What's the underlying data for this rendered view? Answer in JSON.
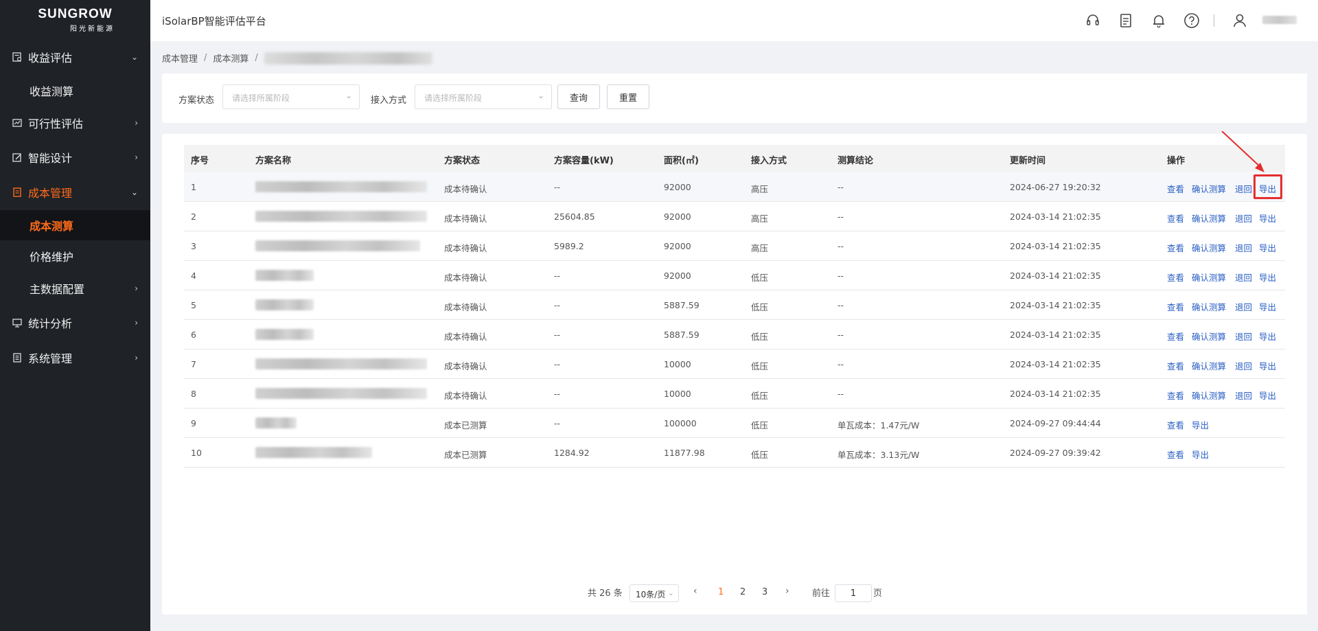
{
  "logo": {
    "brand": "SUNGROW",
    "sub": "阳光新能源"
  },
  "header": {
    "title": "iSolarBP智能评估平台"
  },
  "sidebar": {
    "items": [
      {
        "label": "收益评估"
      },
      {
        "label": "收益测算"
      },
      {
        "label": "可行性评估"
      },
      {
        "label": "智能设计"
      },
      {
        "label": "成本管理"
      },
      {
        "label": "成本测算"
      },
      {
        "label": "价格维护"
      },
      {
        "label": "主数据配置"
      },
      {
        "label": "统计分析"
      },
      {
        "label": "系统管理"
      }
    ]
  },
  "breadcrumb": {
    "level1": "成本管理",
    "level2": "成本测算",
    "sep": "/"
  },
  "filters": {
    "status_label": "方案状态",
    "status_placeholder": "请选择所属阶段",
    "access_label": "接入方式",
    "access_placeholder": "请选择所属阶段",
    "query_label": "查询",
    "reset_label": "重置"
  },
  "table": {
    "columns": [
      "序号",
      "方案名称",
      "方案状态",
      "方案容量(kW)",
      "面积(㎡)",
      "接入方式",
      "测算结论",
      "更新时间",
      "操作"
    ],
    "ops": {
      "view": "查看",
      "confirm": "确认测算",
      "back": "退回",
      "export": "导出"
    },
    "rows": [
      {
        "no": "1",
        "status": "成本待确认",
        "capacity": "--",
        "area": "92000",
        "access": "高压",
        "result": "--",
        "time": "2024-06-27 19:20:32"
      },
      {
        "no": "2",
        "status": "成本待确认",
        "capacity": "25604.85",
        "area": "92000",
        "access": "高压",
        "result": "--",
        "time": "2024-03-14 21:02:35"
      },
      {
        "no": "3",
        "status": "成本待确认",
        "capacity": "5989.2",
        "area": "92000",
        "access": "高压",
        "result": "--",
        "time": "2024-03-14 21:02:35"
      },
      {
        "no": "4",
        "status": "成本待确认",
        "capacity": "--",
        "area": "92000",
        "access": "低压",
        "result": "--",
        "time": "2024-03-14 21:02:35"
      },
      {
        "no": "5",
        "status": "成本待确认",
        "capacity": "--",
        "area": "5887.59",
        "access": "低压",
        "result": "--",
        "time": "2024-03-14 21:02:35"
      },
      {
        "no": "6",
        "status": "成本待确认",
        "capacity": "--",
        "area": "5887.59",
        "access": "低压",
        "result": "--",
        "time": "2024-03-14 21:02:35"
      },
      {
        "no": "7",
        "status": "成本待确认",
        "capacity": "--",
        "area": "10000",
        "access": "低压",
        "result": "--",
        "time": "2024-03-14 21:02:35"
      },
      {
        "no": "8",
        "status": "成本待确认",
        "capacity": "--",
        "area": "10000",
        "access": "低压",
        "result": "--",
        "time": "2024-03-14 21:02:35"
      },
      {
        "no": "9",
        "status": "成本已测算",
        "capacity": "--",
        "area": "100000",
        "access": "低压",
        "result": "单瓦成本：1.47元/W",
        "time": "2024-09-27 09:44:44"
      },
      {
        "no": "10",
        "status": "成本已测算",
        "capacity": "1284.92",
        "area": "11877.98",
        "access": "低压",
        "result": "单瓦成本：3.13元/W",
        "time": "2024-09-27 09:39:42"
      }
    ]
  },
  "pagination": {
    "total": "共 26 条",
    "page_size": "10条/页",
    "pages": [
      "1",
      "2",
      "3"
    ],
    "current": "1",
    "goto_label": "前往",
    "goto_value": "1",
    "page_unit": "页"
  },
  "colors": {
    "accent": "#ff6b1a",
    "link": "#2a5fc4",
    "annotation": "#e52d2d",
    "sidebar": "#1f2227"
  }
}
